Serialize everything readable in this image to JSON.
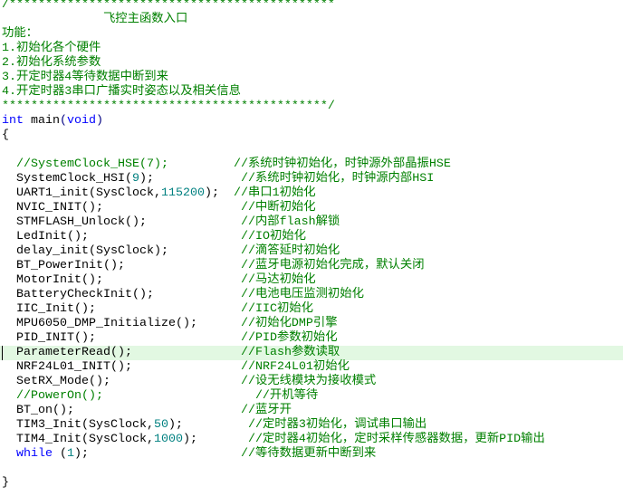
{
  "editor": {
    "current_line": 24,
    "colors": {
      "comment": "#008000",
      "keyword": "#0000ff",
      "number": "#008080",
      "current_line_bg": "#e2f8e2"
    },
    "lines": [
      {
        "segs": [
          {
            "t": "/*********************************************",
            "k": "cm"
          }
        ]
      },
      {
        "segs": [
          {
            "t": "              飞控主函数入口",
            "k": "cm"
          }
        ]
      },
      {
        "segs": [
          {
            "t": "功能：",
            "k": "cm"
          }
        ]
      },
      {
        "segs": [
          {
            "t": "1.初始化各个硬件",
            "k": "cm"
          }
        ]
      },
      {
        "segs": [
          {
            "t": "2.初始化系统参数",
            "k": "cm"
          }
        ]
      },
      {
        "segs": [
          {
            "t": "3.开定时器4等待数据中断到来",
            "k": "cm"
          }
        ]
      },
      {
        "segs": [
          {
            "t": "4.开定时器3串口广播实时姿态以及相关信息",
            "k": "cm"
          }
        ]
      },
      {
        "segs": [
          {
            "t": "*********************************************/",
            "k": "cm"
          }
        ]
      },
      {
        "segs": [
          {
            "t": "int",
            "k": "kw"
          },
          {
            "t": " main",
            "k": "tx"
          },
          {
            "t": "(",
            "k": "pn"
          },
          {
            "t": "void",
            "k": "kw"
          },
          {
            "t": ")",
            "k": "pn"
          }
        ]
      },
      {
        "segs": [
          {
            "t": "{",
            "k": "tx"
          }
        ]
      },
      {
        "segs": [
          {
            "t": "",
            "k": "tx"
          }
        ]
      },
      {
        "segs": [
          {
            "t": "  //SystemClock_HSE(7);         ",
            "k": "cm"
          },
          {
            "t": "//系统时钟初始化，时钟源外部晶振HSE",
            "k": "cm"
          }
        ]
      },
      {
        "segs": [
          {
            "t": "  SystemClock_HSI(",
            "k": "tx"
          },
          {
            "t": "9",
            "k": "num"
          },
          {
            "t": ");            ",
            "k": "tx"
          },
          {
            "t": "//系统时钟初始化，时钟源内部HSI",
            "k": "cm"
          }
        ]
      },
      {
        "segs": [
          {
            "t": "  UART1_init(SysClock,",
            "k": "tx"
          },
          {
            "t": "115200",
            "k": "num"
          },
          {
            "t": ");  ",
            "k": "tx"
          },
          {
            "t": "//串口1初始化",
            "k": "cm"
          }
        ]
      },
      {
        "segs": [
          {
            "t": "  NVIC_INIT();                   ",
            "k": "tx"
          },
          {
            "t": "//中断初始化",
            "k": "cm"
          }
        ]
      },
      {
        "segs": [
          {
            "t": "  STMFLASH_Unlock();             ",
            "k": "tx"
          },
          {
            "t": "//内部flash解锁",
            "k": "cm"
          }
        ]
      },
      {
        "segs": [
          {
            "t": "  LedInit();                     ",
            "k": "tx"
          },
          {
            "t": "//IO初始化",
            "k": "cm"
          }
        ]
      },
      {
        "segs": [
          {
            "t": "  delay_init(SysClock);          ",
            "k": "tx"
          },
          {
            "t": "//滴答延时初始化",
            "k": "cm"
          }
        ]
      },
      {
        "segs": [
          {
            "t": "  BT_PowerInit();                ",
            "k": "tx"
          },
          {
            "t": "//蓝牙电源初始化完成，默认关闭",
            "k": "cm"
          }
        ]
      },
      {
        "segs": [
          {
            "t": "  MotorInit();                   ",
            "k": "tx"
          },
          {
            "t": "//马达初始化",
            "k": "cm"
          }
        ]
      },
      {
        "segs": [
          {
            "t": "  BatteryCheckInit();            ",
            "k": "tx"
          },
          {
            "t": "//电池电压监测初始化",
            "k": "cm"
          }
        ]
      },
      {
        "segs": [
          {
            "t": "  IIC_Init();                    ",
            "k": "tx"
          },
          {
            "t": "//IIC初始化",
            "k": "cm"
          }
        ]
      },
      {
        "segs": [
          {
            "t": "  MPU6050_DMP_Initialize();      ",
            "k": "tx"
          },
          {
            "t": "//初始化DMP引擎",
            "k": "cm"
          }
        ]
      },
      {
        "segs": [
          {
            "t": "  PID_INIT();                    ",
            "k": "tx"
          },
          {
            "t": "//PID参数初始化",
            "k": "cm"
          }
        ]
      },
      {
        "segs": [
          {
            "t": "  ParameterRead();               ",
            "k": "tx"
          },
          {
            "t": "//Flash参数读取",
            "k": "cm"
          }
        ]
      },
      {
        "segs": [
          {
            "t": "  NRF24L01_INIT();               ",
            "k": "tx"
          },
          {
            "t": "//NRF24L01初始化",
            "k": "cm"
          }
        ]
      },
      {
        "segs": [
          {
            "t": "  SetRX_Mode();                  ",
            "k": "tx"
          },
          {
            "t": "//设无线模块为接收模式",
            "k": "cm"
          }
        ]
      },
      {
        "segs": [
          {
            "t": "  //PowerOn();                     ",
            "k": "cm"
          },
          {
            "t": "//开机等待",
            "k": "cm"
          }
        ]
      },
      {
        "segs": [
          {
            "t": "  BT_on();                       ",
            "k": "tx"
          },
          {
            "t": "//蓝牙开",
            "k": "cm"
          }
        ]
      },
      {
        "segs": [
          {
            "t": "  TIM3_Init(SysClock,",
            "k": "tx"
          },
          {
            "t": "50",
            "k": "num"
          },
          {
            "t": ");         ",
            "k": "tx"
          },
          {
            "t": "//定时器3初始化，调试串口输出",
            "k": "cm"
          }
        ]
      },
      {
        "segs": [
          {
            "t": "  TIM4_Init(SysClock,",
            "k": "tx"
          },
          {
            "t": "1000",
            "k": "num"
          },
          {
            "t": ");       ",
            "k": "tx"
          },
          {
            "t": "//定时器4初始化，定时采样传感器数据，更新PID输出",
            "k": "cm"
          }
        ]
      },
      {
        "segs": [
          {
            "t": "  ",
            "k": "tx"
          },
          {
            "t": "while",
            "k": "kw"
          },
          {
            "t": " (",
            "k": "tx"
          },
          {
            "t": "1",
            "k": "num"
          },
          {
            "t": ");                     ",
            "k": "tx"
          },
          {
            "t": "//等待数据更新中断到来",
            "k": "cm"
          }
        ]
      },
      {
        "segs": [
          {
            "t": "",
            "k": "tx"
          }
        ]
      },
      {
        "segs": [
          {
            "t": "}",
            "k": "tx"
          }
        ]
      }
    ]
  }
}
